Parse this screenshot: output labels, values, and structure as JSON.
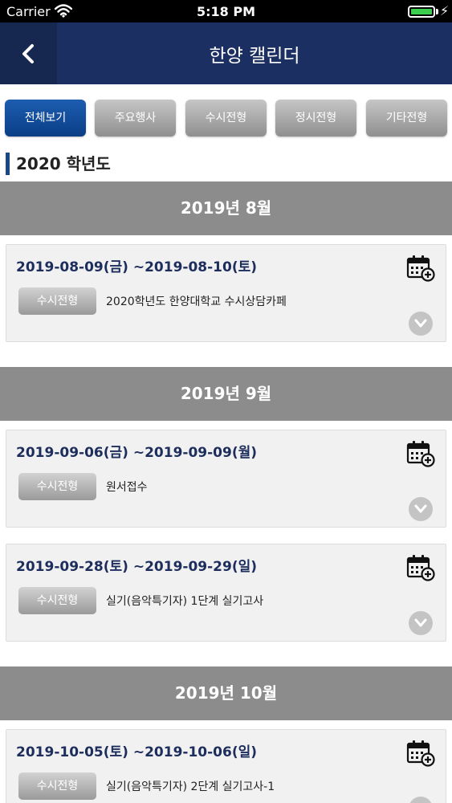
{
  "status_bar": {
    "carrier": "Carrier",
    "time": "5:18 PM"
  },
  "nav": {
    "title": "한양 캘린더"
  },
  "tabs": [
    {
      "label": "전체보기"
    },
    {
      "label": "주요행사"
    },
    {
      "label": "수시전형"
    },
    {
      "label": "정시전형"
    },
    {
      "label": "기타전형"
    }
  ],
  "year_header": "2020 학년도",
  "months": [
    {
      "label": "2019년 8월"
    },
    {
      "label": "2019년 9월"
    },
    {
      "label": "2019년 10월"
    }
  ],
  "events": [
    {
      "date": "2019-08-09(금) ~2019-08-10(토)",
      "category": "수시전형",
      "title": "2020학년도 한양대학교 수시상담카페"
    },
    {
      "date": "2019-09-06(금) ~2019-09-09(월)",
      "category": "수시전형",
      "title": "원서접수"
    },
    {
      "date": "2019-09-28(토) ~2019-09-29(일)",
      "category": "수시전형",
      "title": "실기(음악특기자) 1단계 실기고사"
    },
    {
      "date": "2019-10-05(토) ~2019-10-06(일)",
      "category": "수시전형",
      "title": "실기(음악특기자) 2단계 실기고사-1"
    }
  ],
  "colors": {
    "nav_bg": "#1c2f62",
    "active_tab": "#0a3e86",
    "month_band": "#8c8c8c",
    "date_text": "#1d2d5c",
    "battery": "#3ccf4e"
  },
  "icons": [
    "wifi-icon",
    "battery-icon",
    "back-chevron-icon",
    "calendar-add-icon",
    "chevron-down-icon"
  ]
}
